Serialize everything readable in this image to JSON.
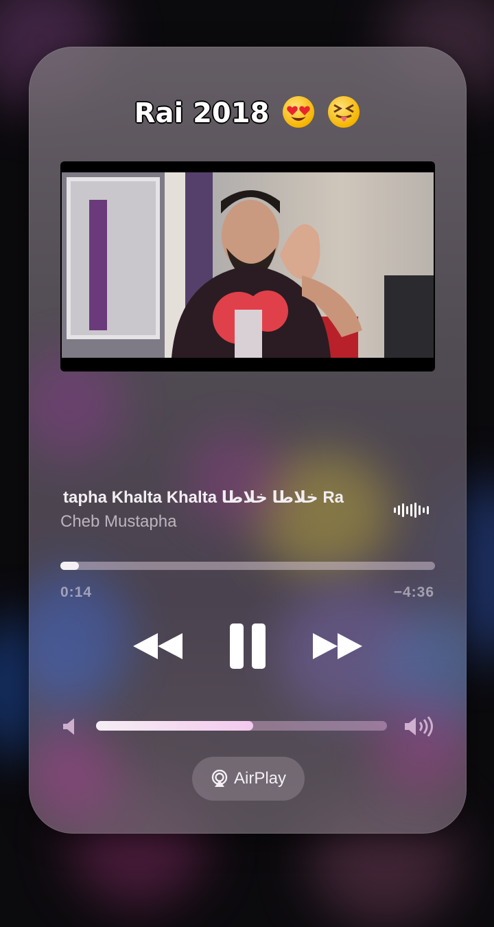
{
  "overlay": {
    "caption": "Rai 2018",
    "emojis": [
      "heart-eyes-emoji",
      "squinting-tongue-emoji"
    ]
  },
  "now_playing": {
    "title": "tapha Khalta Khalta خلاطا خلاطا  Ra",
    "artist": "Cheb Mustapha",
    "progress": 0.05,
    "elapsed": "0:14",
    "remaining": "−4:36"
  },
  "controls": {
    "rewind_icon": "rewind-icon",
    "pause_icon": "pause-icon",
    "forward_icon": "fast-forward-icon"
  },
  "volume": {
    "level": 0.54
  },
  "airplay": {
    "label": "AirPlay",
    "icon": "airplay-icon"
  },
  "colors": {
    "accent_volume": "#f3c9ee",
    "progress_fill": "#f3eff3"
  }
}
